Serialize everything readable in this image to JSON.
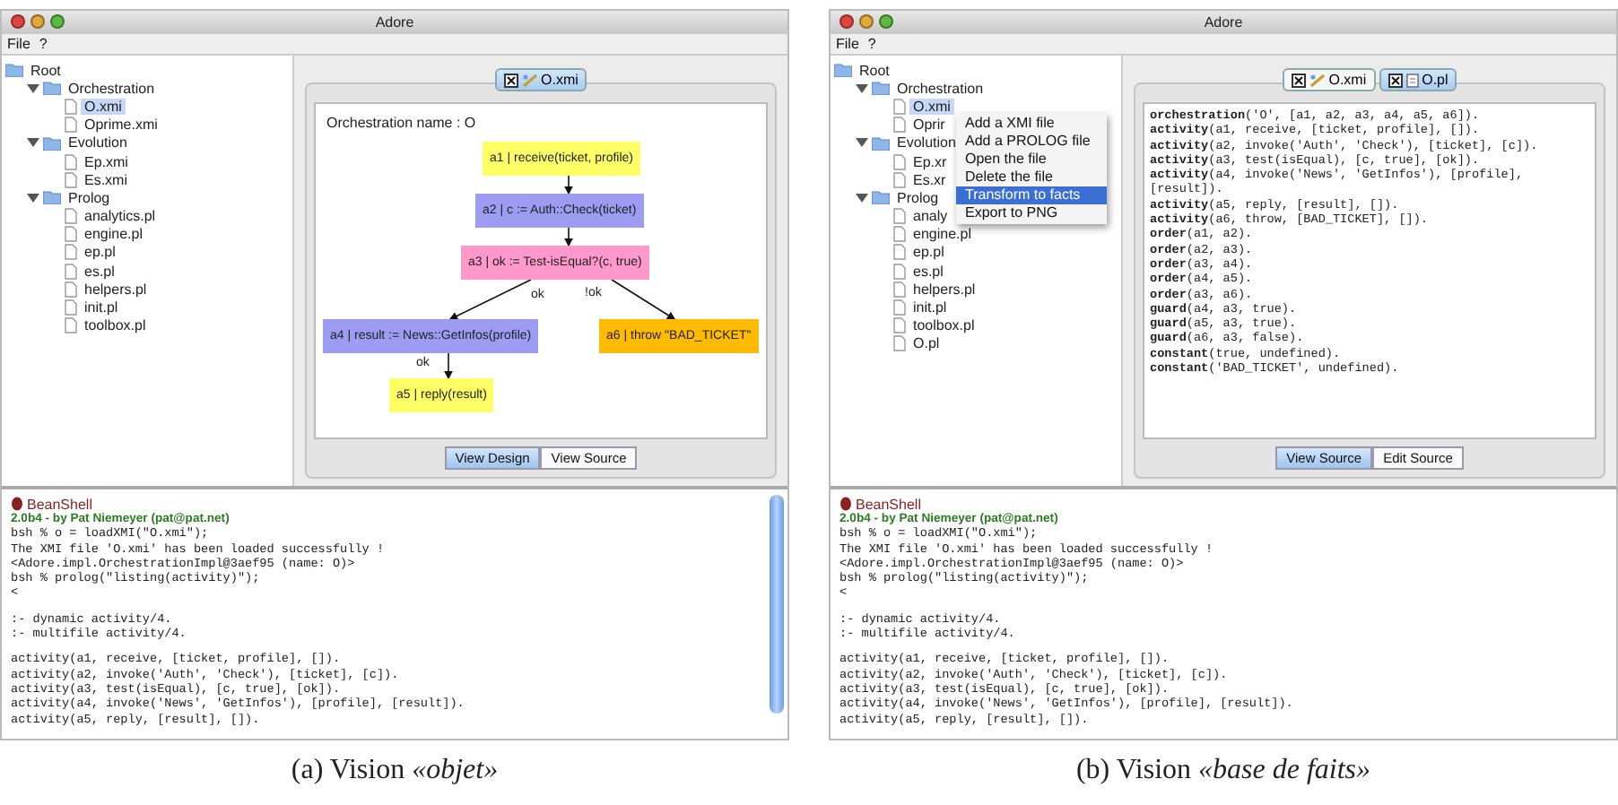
{
  "figures": [
    {
      "window": {
        "title": "Adore"
      },
      "menu": [
        "File",
        "?"
      ],
      "tree": [
        {
          "label": "Root",
          "kind": "root",
          "children": [
            {
              "label": "Orchestration",
              "kind": "folder",
              "expanded": true,
              "children": [
                {
                  "label": "O.xmi",
                  "kind": "file",
                  "selected": true
                },
                {
                  "label": "Oprime.xmi",
                  "kind": "file",
                  "selected": false
                }
              ]
            },
            {
              "label": "Evolution",
              "kind": "folder",
              "expanded": true,
              "children": [
                {
                  "label": "Ep.xmi",
                  "kind": "file",
                  "selected": false
                },
                {
                  "label": "Es.xmi",
                  "kind": "file",
                  "selected": false
                }
              ]
            },
            {
              "label": "Prolog",
              "kind": "folder",
              "expanded": true,
              "children": [
                {
                  "label": "analytics.pl",
                  "kind": "file",
                  "selected": false
                },
                {
                  "label": "engine.pl",
                  "kind": "file",
                  "selected": false
                },
                {
                  "label": "ep.pl",
                  "kind": "file",
                  "selected": false
                },
                {
                  "label": "es.pl",
                  "kind": "file",
                  "selected": false
                },
                {
                  "label": "helpers.pl",
                  "kind": "file",
                  "selected": false
                },
                {
                  "label": "init.pl",
                  "kind": "file",
                  "selected": false
                },
                {
                  "label": "toolbox.pl",
                  "kind": "file",
                  "selected": false
                }
              ]
            }
          ]
        }
      ],
      "editor": {
        "tabs": [
          {
            "label": "O.xmi",
            "kind": "diagram",
            "selected": true
          }
        ],
        "content": {
          "kind": "diagram",
          "title": "Orchestration name : O",
          "nodes": [
            {
              "label": "a1 | receive(ticket, profile)",
              "color": "#ffff66"
            },
            {
              "label": "a2 | c := Auth::Check(ticket)",
              "color": "#9c9cf2"
            },
            {
              "label": "a3 | ok := Test-isEqual?(c, true)",
              "color": "#ff99cc"
            },
            {
              "label": "a4 | result := News::GetInfos(profile)",
              "color": "#9c9cf2"
            },
            {
              "label": "a5 | reply(result)",
              "color": "#ffff66"
            },
            {
              "label": "a6 | throw \"BAD_TICKET\"",
              "color": "#ffbb00"
            }
          ],
          "edge_labels": [
            "ok",
            "!ok",
            "ok"
          ]
        },
        "view_buttons": [
          {
            "label": "View Design",
            "selected": true
          },
          {
            "label": "View Source",
            "selected": false
          }
        ]
      },
      "console": {
        "title": "BeanShell",
        "banner": "2.0b4 - by Pat Niemeyer (pat@pat.net)",
        "scrollbar": true,
        "blocks": [
          [
            "bsh % o = loadXMI(\"O.xmi\");",
            "The XMI file 'O.xmi' has been loaded successfully !",
            "<Adore.impl.OrchestrationImpl@3aef95 (name: O)>",
            "bsh % prolog(\"listing(activity)\");",
            "<"
          ],
          [
            ":- dynamic activity/4.",
            ":- multifile activity/4."
          ],
          [
            "activity(a1, receive, [ticket, profile], []).",
            "activity(a2, invoke('Auth', 'Check'), [ticket], [c]).",
            "activity(a3, test(isEqual), [c, true], [ok]).",
            "activity(a4, invoke('News', 'GetInfos'), [profile], [result]).",
            "activity(a5, reply, [result], [])."
          ]
        ]
      },
      "caption": "(a)  Vision *«objet»*"
    },
    {
      "window": {
        "title": "Adore"
      },
      "menu": [
        "File",
        "?"
      ],
      "tree": [
        {
          "label": "Root",
          "kind": "root",
          "children": [
            {
              "label": "Orchestration",
              "kind": "folder",
              "expanded": true,
              "children": [
                {
                  "label": "O.xmi",
                  "kind": "file",
                  "selected": true
                },
                {
                  "label": "Oprir",
                  "kind": "file",
                  "selected": false
                }
              ]
            },
            {
              "label": "Evolution",
              "kind": "folder",
              "expanded": true,
              "children": [
                {
                  "label": "Ep.xr",
                  "kind": "file",
                  "selected": false
                },
                {
                  "label": "Es.xr",
                  "kind": "file",
                  "selected": false
                }
              ]
            },
            {
              "label": "Prolog",
              "kind": "folder",
              "expanded": true,
              "children": [
                {
                  "label": "analy",
                  "kind": "file",
                  "selected": false
                },
                {
                  "label": "engine.pl",
                  "kind": "file",
                  "selected": false
                },
                {
                  "label": "ep.pl",
                  "kind": "file",
                  "selected": false
                },
                {
                  "label": "es.pl",
                  "kind": "file",
                  "selected": false
                },
                {
                  "label": "helpers.pl",
                  "kind": "file",
                  "selected": false
                },
                {
                  "label": "init.pl",
                  "kind": "file",
                  "selected": false
                },
                {
                  "label": "toolbox.pl",
                  "kind": "file",
                  "selected": false
                },
                {
                  "label": "O.pl",
                  "kind": "file",
                  "selected": false
                }
              ]
            }
          ]
        }
      ],
      "context_menu": [
        {
          "label": "Add a XMI file",
          "selected": false
        },
        {
          "label": "Add a PROLOG file",
          "selected": false
        },
        {
          "label": "Open the file",
          "selected": false
        },
        {
          "label": "Delete the file",
          "selected": false
        },
        {
          "label": "Transform to facts",
          "selected": true
        },
        {
          "label": "Export to PNG",
          "selected": false
        }
      ],
      "editor": {
        "tabs": [
          {
            "label": "O.xmi",
            "kind": "diagram",
            "selected": false
          },
          {
            "label": "O.pl",
            "kind": "source",
            "selected": true
          }
        ],
        "content": {
          "kind": "source",
          "lines": [
            "**orchestration**('O', [a1, a2, a3, a4, a5, a6]).",
            "**activity**(a1, receive, [ticket, profile], []).",
            "**activity**(a2, invoke('Auth', 'Check'), [ticket], [c]).",
            "**activity**(a3, test(isEqual), [c, true], [ok]).",
            "**activity**(a4, invoke('News', 'GetInfos'), [profile],",
            "[result]).",
            "**activity**(a5, reply, [result], []).",
            "**activity**(a6, throw, [BAD_TICKET], []).",
            "**order**(a1, a2).",
            "**order**(a2, a3).",
            "**order**(a3, a4).",
            "**order**(a4, a5).",
            "**order**(a3, a6).",
            "**guard**(a4, a3, true).",
            "**guard**(a5, a3, true).",
            "**guard**(a6, a3, false).",
            "**constant**(true, undefined).",
            "**constant**('BAD_TICKET', undefined)."
          ]
        },
        "view_buttons": [
          {
            "label": "View Source",
            "selected": true
          },
          {
            "label": "Edit Source",
            "selected": false
          }
        ]
      },
      "console": {
        "title": "BeanShell",
        "banner": "2.0b4 - by Pat Niemeyer (pat@pat.net)",
        "scrollbar": false,
        "blocks": [
          [
            "bsh % o = loadXMI(\"O.xmi\");",
            "The XMI file 'O.xmi' has been loaded successfully !",
            "<Adore.impl.OrchestrationImpl@3aef95 (name: O)>",
            "bsh % prolog(\"listing(activity)\");",
            "<"
          ],
          [
            ":- dynamic activity/4.",
            ":- multifile activity/4."
          ],
          [
            "activity(a1, receive, [ticket, profile], []).",
            "activity(a2, invoke('Auth', 'Check'), [ticket], [c]).",
            "activity(a3, test(isEqual), [c, true], [ok]).",
            "activity(a4, invoke('News', 'GetInfos'), [profile], [result]).",
            "activity(a5, reply, [result], [])."
          ]
        ]
      },
      "caption": "(b)  Vision *«base de faits»*"
    }
  ]
}
